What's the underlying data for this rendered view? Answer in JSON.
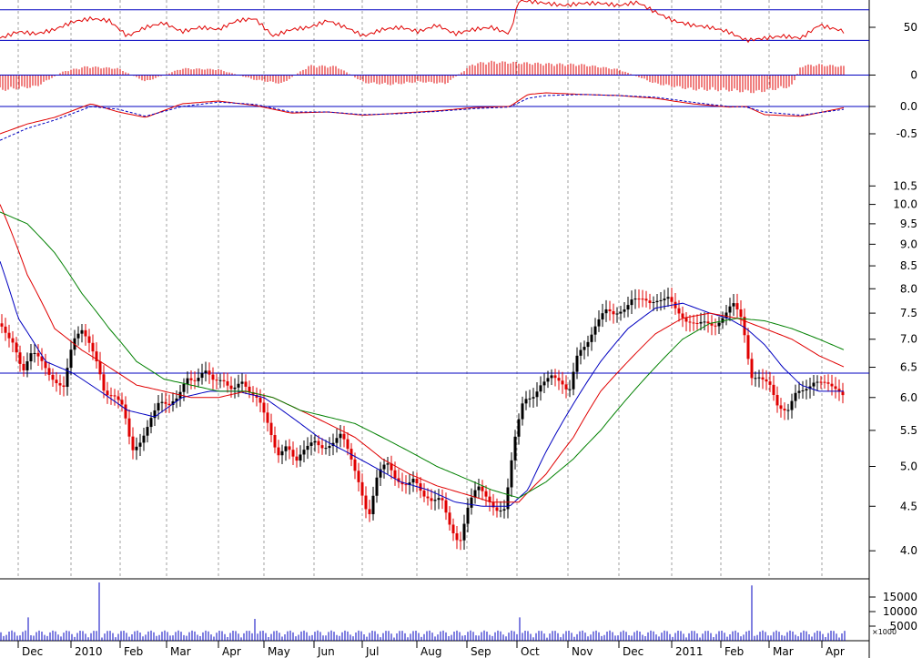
{
  "chart_data": [
    {
      "type": "line",
      "panel": "oscillator-upper",
      "y_ticks": [
        50
      ],
      "reference_lines": [
        38,
        66
      ],
      "ylim": [
        25,
        75
      ],
      "grid": "vertical dashed at months",
      "series": [
        {
          "color": "#e00000",
          "x": [
            0,
            20,
            40,
            60,
            80,
            100,
            120,
            140,
            160,
            180,
            200,
            220,
            240,
            260,
            280,
            300,
            320,
            340,
            360,
            380,
            400,
            420,
            440,
            460,
            480,
            500,
            520,
            540,
            560,
            570,
            580,
            600,
            620,
            640,
            660,
            680,
            700,
            720,
            740,
            760,
            780,
            800,
            820,
            840,
            860,
            880,
            900,
            920,
            928
          ],
          "values": [
            40,
            46,
            44,
            48,
            55,
            58,
            56,
            42,
            50,
            54,
            46,
            50,
            48,
            56,
            58,
            42,
            48,
            50,
            56,
            50,
            42,
            48,
            50,
            46,
            52,
            44,
            48,
            50,
            44,
            74,
            74,
            72,
            70,
            72,
            72,
            70,
            73,
            64,
            56,
            52,
            50,
            46,
            38,
            40,
            42,
            40,
            52,
            48,
            46
          ]
        }
      ]
    },
    {
      "type": "bar",
      "panel": "histogram",
      "y_ticks": [
        0
      ],
      "ylim": [
        -1,
        1
      ],
      "zero_line": 0,
      "bar_color": "#e00000",
      "x_range": [
        0,
        928
      ],
      "envelope": {
        "x": [
          0,
          40,
          70,
          95,
          130,
          160,
          200,
          240,
          280,
          310,
          340,
          370,
          400,
          430,
          460,
          490,
          520,
          540,
          570,
          600,
          640,
          680,
          720,
          760,
          800,
          830,
          870,
          880,
          900,
          928
        ],
        "values": [
          -0.8,
          -0.6,
          0.2,
          0.45,
          0.35,
          -0.35,
          0.35,
          0.3,
          -0.25,
          -0.45,
          0.5,
          0.45,
          -0.4,
          -0.5,
          -0.35,
          -0.45,
          0.6,
          0.7,
          0.65,
          0.6,
          0.55,
          0.3,
          -0.45,
          -0.75,
          -0.8,
          -0.9,
          -0.6,
          0.5,
          0.55,
          0.45
        ]
      }
    },
    {
      "type": "line",
      "panel": "macd",
      "y_ticks": [
        0.0,
        -0.5
      ],
      "ylim": [
        -0.8,
        0.2
      ],
      "zero_line": 0.0,
      "series": [
        {
          "color": "#e00000",
          "style": "solid",
          "x": [
            0,
            30,
            60,
            100,
            130,
            160,
            200,
            240,
            280,
            320,
            360,
            400,
            440,
            480,
            520,
            560,
            580,
            600,
            640,
            680,
            720,
            760,
            800,
            820,
            840,
            880,
            928
          ],
          "values": [
            -0.5,
            -0.32,
            -0.2,
            0.05,
            -0.1,
            -0.2,
            0.05,
            0.1,
            0.02,
            -0.12,
            -0.1,
            -0.16,
            -0.12,
            -0.08,
            -0.02,
            0.0,
            0.22,
            0.25,
            0.22,
            0.2,
            0.15,
            0.05,
            -0.01,
            0.0,
            -0.15,
            -0.18,
            -0.02
          ]
        },
        {
          "color": "#0000c0",
          "style": "dashed",
          "x": [
            0,
            30,
            60,
            100,
            130,
            160,
            200,
            240,
            280,
            320,
            360,
            400,
            440,
            480,
            520,
            560,
            580,
            600,
            640,
            680,
            720,
            760,
            800,
            820,
            840,
            880,
            928
          ],
          "values": [
            -0.62,
            -0.4,
            -0.25,
            0.0,
            -0.05,
            -0.18,
            0.0,
            0.08,
            0.04,
            -0.1,
            -0.1,
            -0.15,
            -0.13,
            -0.09,
            -0.04,
            -0.01,
            0.15,
            0.2,
            0.22,
            0.2,
            0.17,
            0.08,
            0.0,
            -0.01,
            -0.1,
            -0.16,
            -0.05
          ]
        }
      ]
    },
    {
      "type": "line",
      "panel": "price",
      "scale": "log",
      "y_ticks": [
        10.5,
        10.0,
        9.5,
        9.0,
        8.5,
        8.0,
        7.5,
        7.0,
        6.5,
        6.0,
        5.5,
        5.0,
        4.5,
        4.0
      ],
      "ylim": [
        3.75,
        11.0
      ],
      "reference_line": 6.4,
      "x_labels": [
        "Dec",
        "2010",
        "Feb",
        "Mar",
        "Apr",
        "May",
        "Jun",
        "Jul",
        "Aug",
        "Sep",
        "Oct",
        "Nov",
        "Dec",
        "2011",
        "Feb",
        "Mar",
        "Apr"
      ],
      "candles": {
        "up_color": "#000000",
        "down_color": "#e00000",
        "close_path": {
          "x": [
            0,
            15,
            25,
            35,
            45,
            55,
            70,
            80,
            90,
            100,
            108,
            115,
            125,
            135,
            145,
            155,
            165,
            175,
            185,
            195,
            205,
            215,
            225,
            235,
            245,
            255,
            265,
            275,
            285,
            295,
            305,
            315,
            325,
            335,
            345,
            355,
            365,
            375,
            385,
            395,
            405,
            415,
            425,
            435,
            445,
            455,
            465,
            475,
            485,
            495,
            505,
            515,
            525,
            535,
            545,
            555,
            565,
            570,
            575,
            585,
            595,
            605,
            615,
            625,
            635,
            645,
            655,
            665,
            675,
            685,
            695,
            705,
            715,
            725,
            735,
            745,
            755,
            765,
            775,
            785,
            795,
            805,
            815,
            825,
            835,
            845,
            855,
            865,
            875,
            885,
            895,
            905,
            915,
            928
          ],
          "values": [
            7.3,
            7.0,
            6.4,
            6.7,
            6.6,
            6.4,
            6.2,
            6.9,
            7.1,
            6.9,
            6.6,
            6.1,
            6.0,
            5.8,
            5.2,
            5.4,
            5.7,
            5.9,
            5.8,
            6.0,
            6.4,
            6.3,
            6.4,
            6.2,
            6.3,
            6.2,
            6.3,
            6.0,
            5.9,
            5.6,
            5.2,
            5.3,
            5.0,
            5.2,
            5.4,
            5.3,
            5.3,
            5.4,
            5.1,
            4.8,
            4.4,
            4.9,
            5.0,
            4.8,
            4.8,
            4.9,
            4.6,
            4.5,
            4.6,
            4.3,
            4.1,
            4.5,
            4.7,
            4.6,
            4.5,
            4.5,
            5.3,
            5.6,
            5.9,
            6.0,
            6.3,
            6.4,
            6.2,
            6.0,
            6.8,
            7.0,
            7.3,
            7.5,
            7.4,
            7.6,
            7.9,
            7.8,
            7.6,
            7.7,
            7.9,
            7.6,
            7.3,
            7.2,
            7.3,
            7.3,
            7.5,
            7.7,
            7.3,
            6.3,
            6.4,
            6.3,
            5.8,
            5.7,
            6.1,
            6.2,
            6.3,
            6.2,
            6.1,
            6.05
          ]
        }
      },
      "series": [
        {
          "color": "#0000c0",
          "x": [
            0,
            20,
            50,
            80,
            110,
            140,
            170,
            200,
            230,
            260,
            290,
            320,
            350,
            380,
            410,
            440,
            470,
            500,
            530,
            560,
            580,
            600,
            630,
            660,
            690,
            720,
            750,
            780,
            800,
            820,
            840,
            860,
            880,
            900,
            928
          ],
          "values": [
            8.6,
            7.4,
            6.6,
            6.4,
            6.1,
            5.8,
            5.7,
            6.0,
            6.1,
            6.1,
            6.0,
            5.7,
            5.4,
            5.2,
            5.0,
            4.8,
            4.7,
            4.55,
            4.5,
            4.5,
            4.7,
            5.2,
            5.9,
            6.6,
            7.2,
            7.6,
            7.7,
            7.5,
            7.4,
            7.2,
            6.9,
            6.5,
            6.2,
            6.1,
            6.1
          ]
        },
        {
          "color": "#e00000",
          "x": [
            0,
            30,
            60,
            90,
            120,
            150,
            180,
            210,
            240,
            270,
            300,
            330,
            360,
            390,
            420,
            450,
            480,
            510,
            540,
            570,
            600,
            630,
            660,
            690,
            720,
            750,
            780,
            810,
            840,
            870,
            900,
            928
          ],
          "values": [
            10.0,
            8.3,
            7.2,
            6.8,
            6.5,
            6.2,
            6.1,
            6.0,
            6.0,
            6.1,
            6.0,
            5.8,
            5.6,
            5.4,
            5.1,
            4.9,
            4.75,
            4.65,
            4.55,
            4.55,
            4.9,
            5.4,
            6.1,
            6.6,
            7.1,
            7.4,
            7.5,
            7.4,
            7.2,
            7.0,
            6.7,
            6.5
          ]
        },
        {
          "color": "#008000",
          "x": [
            0,
            30,
            60,
            90,
            120,
            150,
            180,
            210,
            240,
            270,
            300,
            330,
            360,
            390,
            420,
            450,
            480,
            510,
            540,
            570,
            600,
            630,
            660,
            690,
            720,
            750,
            780,
            810,
            840,
            870,
            900,
            928
          ],
          "values": [
            9.8,
            9.5,
            8.8,
            7.9,
            7.2,
            6.6,
            6.3,
            6.2,
            6.1,
            6.1,
            6.0,
            5.8,
            5.7,
            5.6,
            5.4,
            5.2,
            5.0,
            4.85,
            4.7,
            4.6,
            4.8,
            5.1,
            5.5,
            6.0,
            6.5,
            7.0,
            7.3,
            7.4,
            7.35,
            7.2,
            7.0,
            6.8
          ]
        }
      ]
    },
    {
      "type": "bar",
      "panel": "volume",
      "y_ticks": [
        15000,
        10000,
        5000
      ],
      "y_unit": "×1000",
      "ylim": [
        0,
        20000
      ],
      "bar_color": "#0000c0",
      "x_range": [
        0,
        928
      ],
      "spikes": {
        "x": [
          110,
          825,
          570,
          30,
          280
        ],
        "values": [
          20000,
          19000,
          8000,
          8000,
          7500
        ]
      },
      "baseline": 3500
    }
  ]
}
